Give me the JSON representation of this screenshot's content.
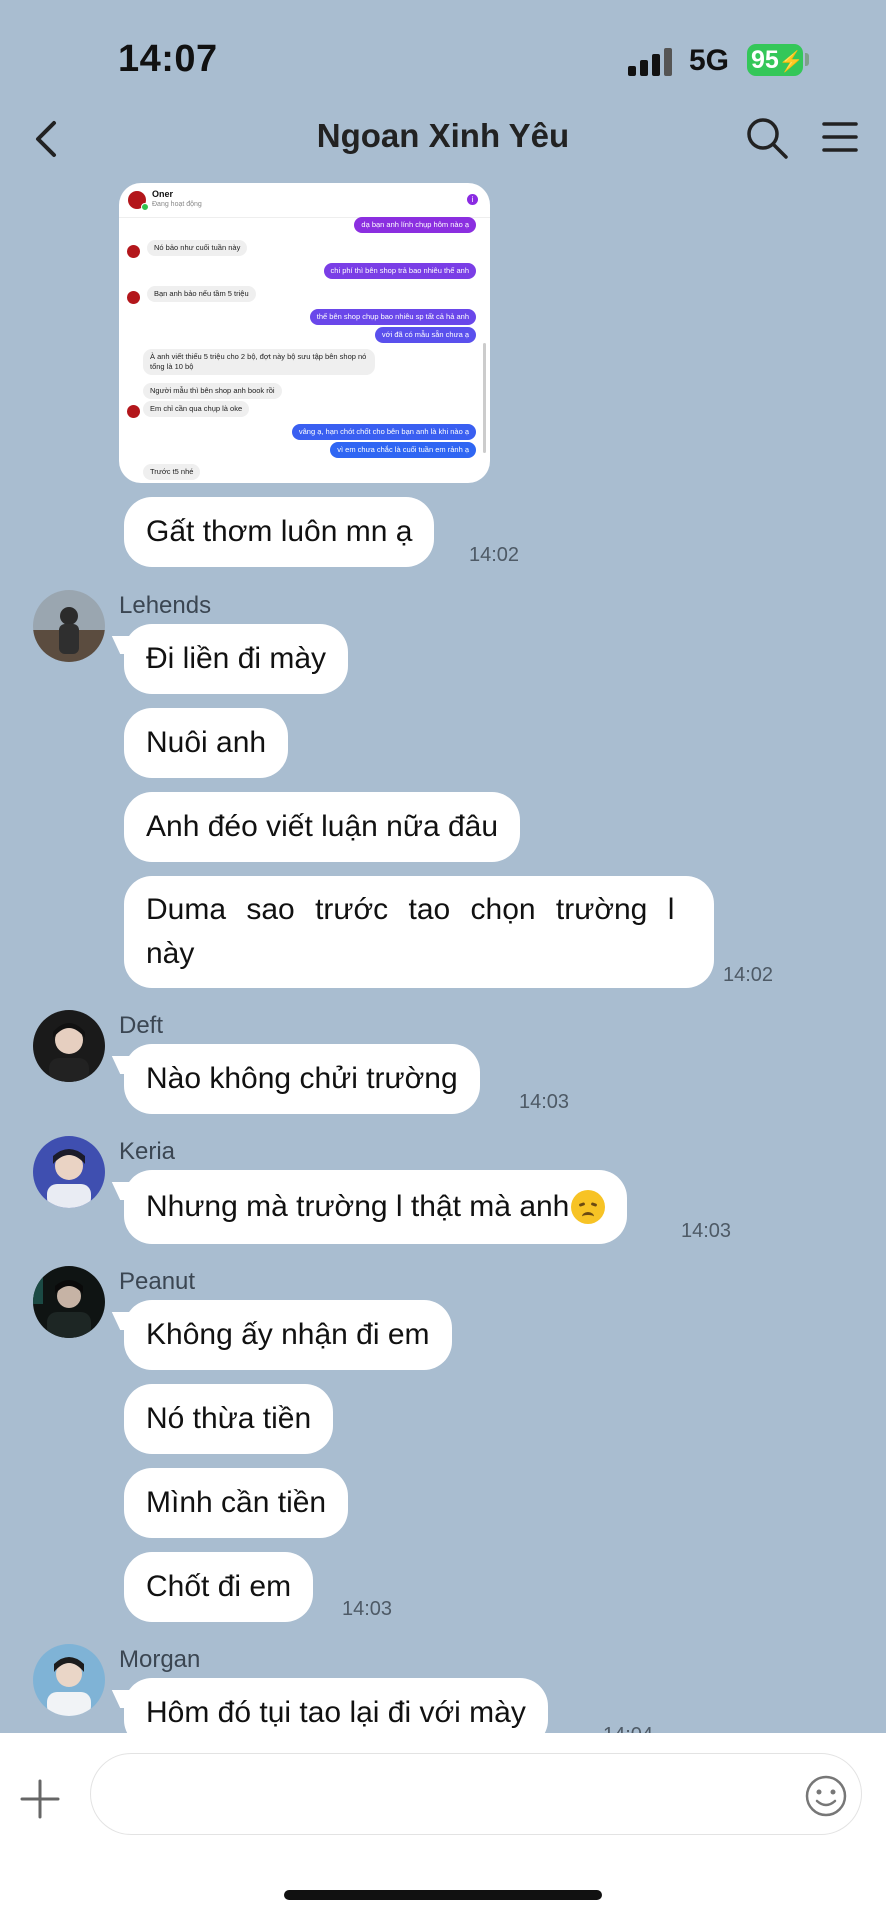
{
  "status_bar": {
    "time": "14:07",
    "network": "5G",
    "battery": "95"
  },
  "header": {
    "title": "Ngoan Xinh Yêu"
  },
  "attachment_screenshot": {
    "contact_name": "Oner",
    "contact_status": "Đang hoạt động",
    "messages": [
      {
        "dir": "out",
        "text": "dạ bạn anh lính chụp hôm nào ạ",
        "color": "#8b2fe0"
      },
      {
        "dir": "in",
        "text": "Nó bảo như cuối tuần này"
      },
      {
        "dir": "out",
        "text": "chi phí thì bên shop trả bao nhiêu thế anh",
        "color": "#7a3ee6"
      },
      {
        "dir": "in",
        "text": "Bạn anh bảo nếu tầm 5 triệu"
      },
      {
        "dir": "out",
        "text": "thế bên shop chụp bao nhiêu sp tất cả hả anh",
        "color": "#6a47ea"
      },
      {
        "dir": "out",
        "text": "với đã có mẫu sẵn chưa ạ",
        "color": "#5a50ed"
      },
      {
        "dir": "in",
        "text": "À anh viết thiếu 5 triệu cho 2 bộ, đợt này bộ sưu tập bên shop nó tổng là 10 bộ"
      },
      {
        "dir": "in",
        "text": "Người mẫu thì bên shop anh book rồi"
      },
      {
        "dir": "in",
        "text": "Em chỉ cần qua chụp là oke"
      },
      {
        "dir": "out",
        "text": "vâng ạ, hạn chót chốt cho bên bạn anh là khi nào ạ",
        "color": "#3a5ff1"
      },
      {
        "dir": "out",
        "text": "vì em chưa chắc là cuối tuần em rảnh ạ",
        "color": "#2f66f3"
      },
      {
        "dir": "in",
        "text": "Trước t5 nhé"
      }
    ]
  },
  "messages": [
    {
      "text": "Gất thơm luôn mn ạ",
      "time": "14:02"
    },
    {
      "sender": "Lehends",
      "texts": [
        "Đi liền đi mày",
        "Nuôi anh",
        "Anh đéo viết luận nữa đâu",
        "Duma sao trước tao chọn trường l này"
      ],
      "time": "14:02"
    },
    {
      "sender": "Deft",
      "texts": [
        "Nào không chửi trường"
      ],
      "time": "14:03"
    },
    {
      "sender": "Keria",
      "texts": [
        "Nhưng mà trường l thật mà anh"
      ],
      "time": "14:03"
    },
    {
      "sender": "Peanut",
      "texts": [
        "Không ấy nhận đi em",
        "Nó thừa tiền",
        "Mình cần tiền",
        "Chốt đi em"
      ],
      "time": "14:03"
    },
    {
      "sender": "Morgan",
      "texts": [
        "Hôm đó tụi tao lại đi với mày"
      ],
      "time": "14:04"
    }
  ],
  "input": {
    "value": "",
    "placeholder": ""
  },
  "colors": {
    "chat_background": "#a9bdd0",
    "bubble": "#ffffff",
    "battery": "#34c759"
  },
  "icons": [
    "back-icon",
    "search-icon",
    "menu-icon",
    "plus-icon",
    "emoji-icon",
    "sad-emoji"
  ]
}
